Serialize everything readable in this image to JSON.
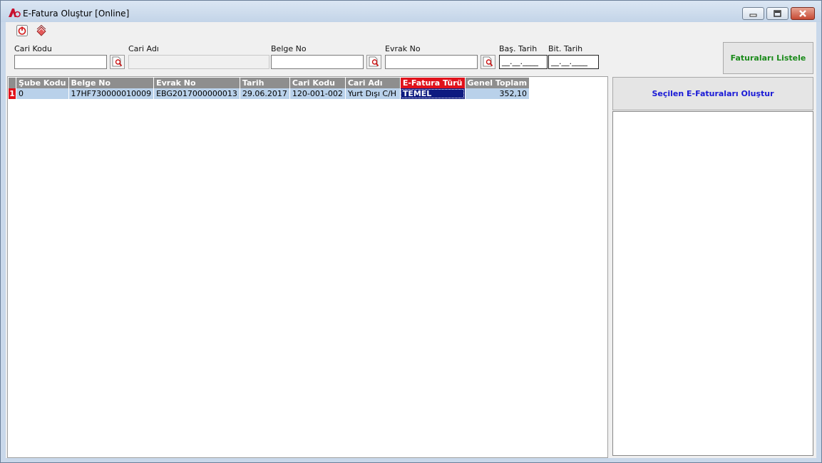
{
  "window": {
    "title": "E-Fatura Oluştur [Online]",
    "controls": [
      "minimize",
      "maximize",
      "close"
    ]
  },
  "toolbar": {
    "items": [
      {
        "icon": "power-icon"
      },
      {
        "icon": "layers-icon"
      }
    ]
  },
  "filters": {
    "cari_kodu": {
      "label": "Cari Kodu",
      "value": ""
    },
    "cari_adi": {
      "label": "Cari Adı",
      "value": ""
    },
    "belge_no": {
      "label": "Belge No",
      "value": ""
    },
    "evrak_no": {
      "label": "Evrak No",
      "value": ""
    },
    "bas_tarih": {
      "label": "Baş. Tarih",
      "value": "__.__.____"
    },
    "bit_tarih": {
      "label": "Bit. Tarih",
      "value": "__.__.____"
    }
  },
  "list_button": {
    "label": "Faturaları Listele",
    "color": "#1a8a1a"
  },
  "create_button": {
    "label": "Seçilen E-Faturaları Oluştur",
    "color": "#1a1ad6"
  },
  "grid": {
    "columns": [
      "Şube Kodu",
      "Belge No",
      "Evrak No",
      "Tarih",
      "Cari Kodu",
      "Cari Adı",
      "E-Fatura Türü",
      "Genel Toplam"
    ],
    "highlighted_column": "E-Fatura Türü",
    "rows": [
      {
        "indicator": "1",
        "sube_kodu": "0",
        "belge_no": "17HF730000010009",
        "evrak_no": "EBG2017000000013",
        "tarih": "29.06.2017",
        "cari_kodu": "120-001-002",
        "cari_adi": "Yurt Dışı C/H",
        "efatura_turu": "TEMEL",
        "genel_toplam": "352,10"
      }
    ]
  },
  "colors": {
    "header_bg": "#8e8e8e",
    "highlight_red": "#e0111b",
    "row_bg": "#b9d1ea",
    "selected_cell": "#0d1a80"
  }
}
